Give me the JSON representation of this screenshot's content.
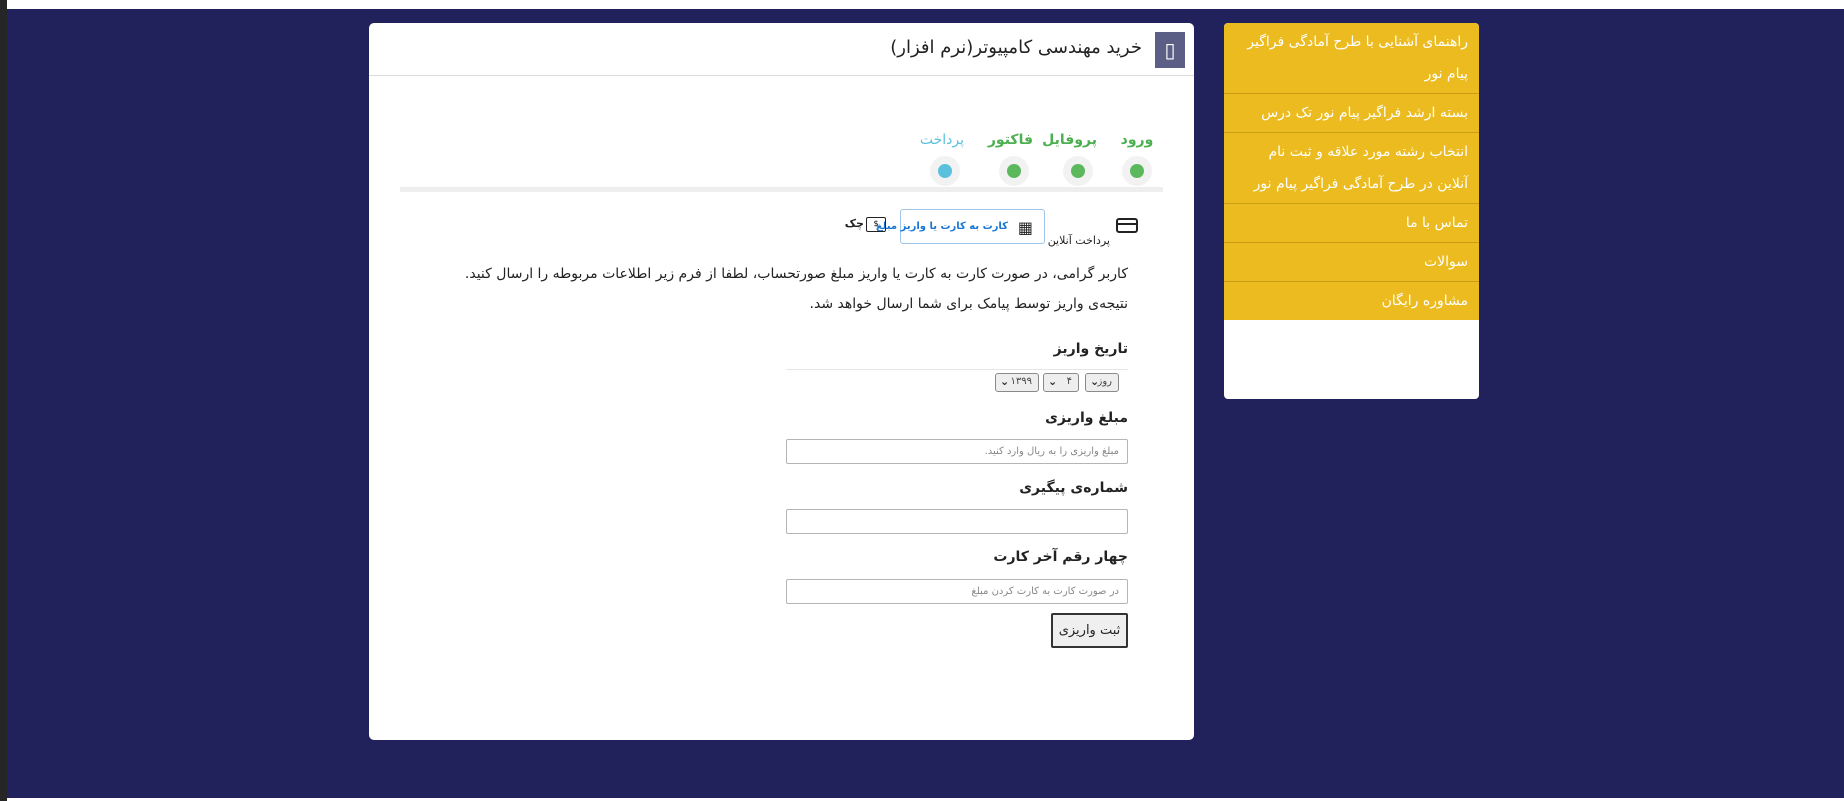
{
  "header": {
    "title": "خرید مهندسی کامپیوتر(نرم افزار)",
    "icon": "menu-icon"
  },
  "steps": [
    {
      "label": "ورود",
      "state": "done"
    },
    {
      "label": "پروفایل",
      "state": "done"
    },
    {
      "label": "فاکتور",
      "state": "done"
    },
    {
      "label": "پرداخت",
      "state": "current"
    }
  ],
  "payment_tabs": {
    "online": "پرداخت آنلاین",
    "card": "کارت به کارت یا واریز مبلغ",
    "check": "چک"
  },
  "message": {
    "line1": "کاربر گرامی، در صورت کارت به کارت یا واریز مبلغ صورتحساب، لطفا از فرم زیر اطلاعات مربوطه را ارسال کنید.",
    "line2": "نتیجه‌ی واریز توسط پیامک برای شما ارسال خواهد شد."
  },
  "form": {
    "date_label": "تاریخ واریز",
    "date": {
      "day": "روز",
      "month": "۴",
      "year": "۱۳۹۹"
    },
    "amount_label": "مبلغ واریزی",
    "amount_placeholder": "مبلغ واریزی را به ریال وارد کنید.",
    "tracking_label": "شماره‌ی پیگیری",
    "tracking_value": "",
    "card_label": "چهار رقم آخر کارت",
    "card_placeholder": "در صورت کارت به کارت کردن مبلغ",
    "submit_label": "ثبت واریزی"
  },
  "sidebar": {
    "items": [
      {
        "label": "راهنمای آشنایی با طرح آمادگی فراگیر پیام نور"
      },
      {
        "label": "بسته ارشد فراگیر پیام نور تک درس"
      },
      {
        "label": "انتخاب رشته مورد علاقه و ثبت نام آنلاین در طرح آمادگی فراگیر پیام نور"
      },
      {
        "label": "تماس با ما"
      },
      {
        "label": "سوالات"
      },
      {
        "label": "مشاوره رایگان"
      }
    ]
  },
  "colors": {
    "page_background": "#21225c",
    "sidebar_background": "#ebbb20",
    "step_done": "#5cb85c",
    "step_current": "#5bc0de"
  }
}
